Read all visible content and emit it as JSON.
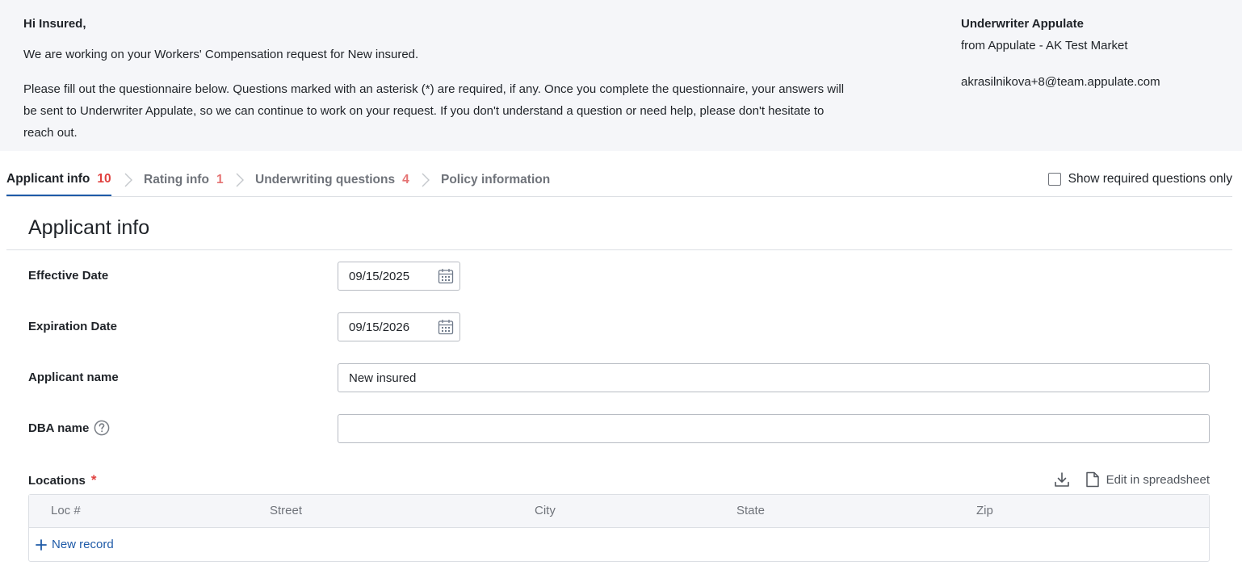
{
  "header": {
    "greeting": "Hi Insured,",
    "intro": "We are working on your Workers' Compensation request for New insured.",
    "instructions": "Please fill out the questionnaire below. Questions marked with an asterisk (*) are required, if any. Once you complete the questionnaire, your answers will be sent to Underwriter Appulate, so we can continue to work on your request. If you don't understand a question or need help, please don't hesitate to reach out.",
    "underwriter_name": "Underwriter Appulate",
    "underwriter_from": "from Appulate - AK Test Market",
    "underwriter_email": "akrasilnikova+8@team.appulate.com"
  },
  "tabs": [
    {
      "label": "Applicant info",
      "count": "10",
      "active": true
    },
    {
      "label": "Rating info",
      "count": "1"
    },
    {
      "label": "Underwriting questions",
      "count": "4"
    },
    {
      "label": "Policy information",
      "count": ""
    }
  ],
  "required_only_label": "Show required questions only",
  "section_title": "Applicant info",
  "fields": {
    "effective_date": {
      "label": "Effective Date",
      "value": "09/15/2025"
    },
    "expiration_date": {
      "label": "Expiration Date",
      "value": "09/15/2026"
    },
    "applicant_name": {
      "label": "Applicant name",
      "value": "New insured"
    },
    "dba_name": {
      "label": "DBA name",
      "value": ""
    }
  },
  "locations": {
    "label": "Locations",
    "required_mark": "*",
    "edit_label": "Edit in spreadsheet",
    "columns": [
      "Loc #",
      "Street",
      "City",
      "State",
      "Zip"
    ],
    "new_record_label": "New record"
  },
  "colors": {
    "accent": "#1f5ba8",
    "required": "#e0413f",
    "header_bg": "#f5f6f9"
  },
  "icons": [
    "calendar-icon",
    "help-icon",
    "download-icon",
    "document-icon",
    "plus-icon",
    "chevron-right-icon"
  ]
}
